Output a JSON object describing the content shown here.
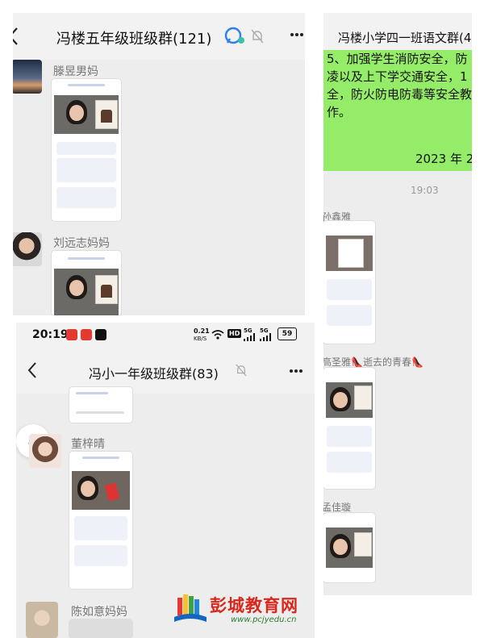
{
  "panel_top_left": {
    "title": "冯楼五年级班级群(121)",
    "members": [
      {
        "name": "滕昱男妈"
      },
      {
        "name": "刘远志妈妈"
      }
    ]
  },
  "panel_top_right": {
    "title": "冯楼小学四一班语文群(4",
    "message_lines": [
      "5、加强学生消防安全，防",
      "凌以及上下学交通安全，1",
      "全，防火防电防毒等安全教",
      "作。"
    ],
    "message_date": "2023 年 2",
    "time_divider": "19:03",
    "members": [
      {
        "name": "孙鑫雅"
      },
      {
        "name": "高圣雅👠逝去的青春👠"
      },
      {
        "name": "孟佳璇"
      }
    ]
  },
  "panel_bottom": {
    "status_bar": {
      "time": "20:19",
      "net_speed_value": "0.21",
      "net_speed_unit": "KB/S",
      "hd_label": "HD",
      "signal_1": "5G",
      "signal_2": "5G",
      "battery": "59"
    },
    "title": "冯小一年级班级群(83)",
    "members": [
      {
        "name": "董梓晴"
      },
      {
        "name": "陈如意妈妈"
      }
    ]
  },
  "watermark": {
    "brand": "彭城教育网",
    "url": "www.pcjyedu.cn"
  },
  "colors": {
    "chat_bg": "#ededed",
    "header_bg": "#f2f2f2",
    "message_green": "#95ec69",
    "brand_red": "#d9271c"
  }
}
